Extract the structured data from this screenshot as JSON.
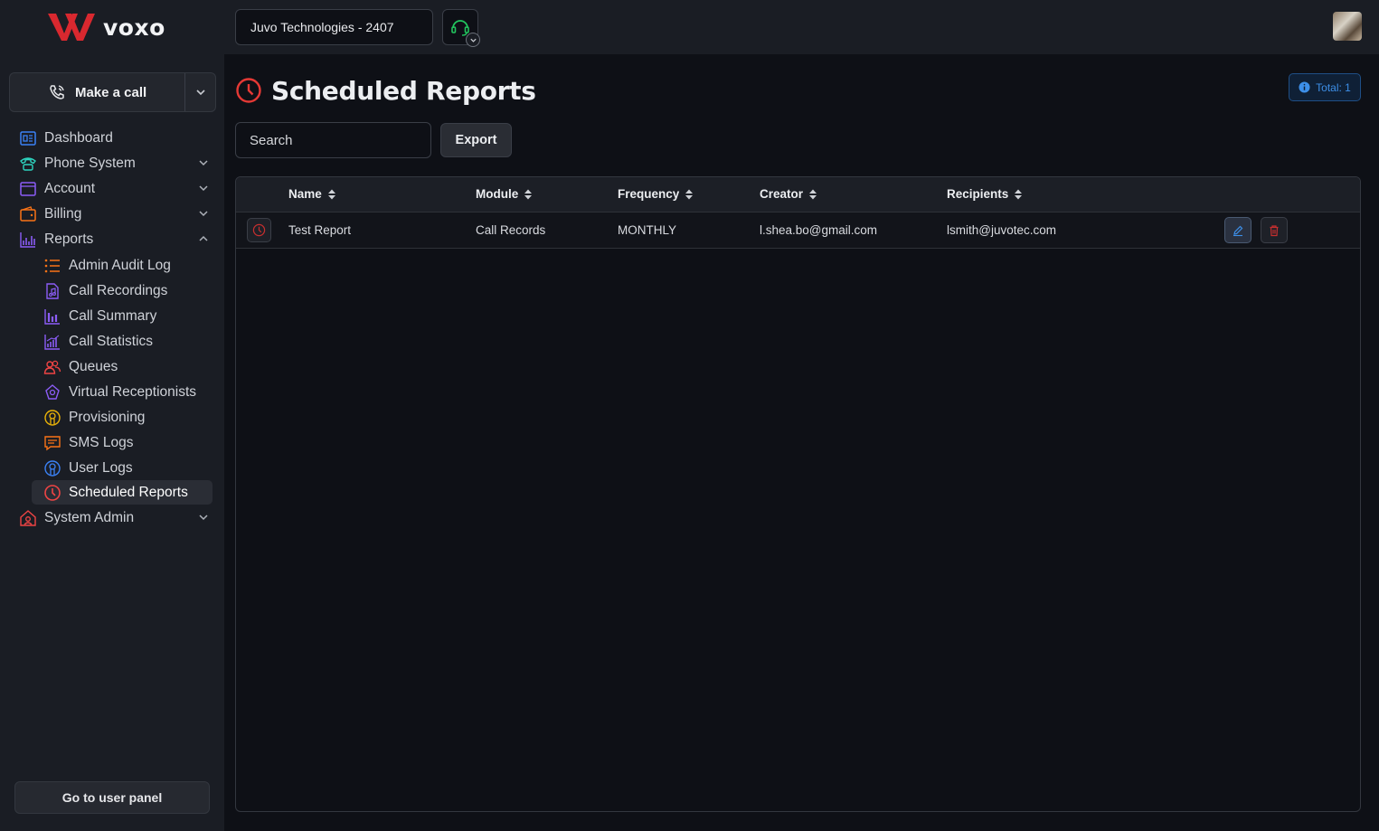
{
  "header": {
    "logo_text": "voxo",
    "org_selector": "Juvo Technologies - 2407"
  },
  "sidebar": {
    "make_call_label": "Make a call",
    "items": [
      {
        "label": "Dashboard",
        "icon": "dashboard-icon"
      },
      {
        "label": "Phone System",
        "icon": "phone-icon"
      },
      {
        "label": "Account",
        "icon": "account-icon"
      },
      {
        "label": "Billing",
        "icon": "wallet-icon"
      },
      {
        "label": "Reports",
        "icon": "chart-icon"
      },
      {
        "label": "System Admin",
        "icon": "admin-icon"
      }
    ],
    "report_items": [
      {
        "label": "Admin Audit Log",
        "icon": "list-icon"
      },
      {
        "label": "Call Recordings",
        "icon": "music-file-icon"
      },
      {
        "label": "Call Summary",
        "icon": "bar-chart-icon"
      },
      {
        "label": "Call Statistics",
        "icon": "statistics-icon"
      },
      {
        "label": "Queues",
        "icon": "users-icon"
      },
      {
        "label": "Virtual Receptionists",
        "icon": "receptionist-icon"
      },
      {
        "label": "Provisioning",
        "icon": "provisioning-icon"
      },
      {
        "label": "SMS Logs",
        "icon": "sms-icon"
      },
      {
        "label": "User Logs",
        "icon": "user-icon"
      },
      {
        "label": "Scheduled Reports",
        "icon": "clock-icon"
      }
    ],
    "user_panel_label": "Go to user panel"
  },
  "main": {
    "title": "Scheduled Reports",
    "total_badge": "Total: 1",
    "search_placeholder": "Search",
    "export_label": "Export",
    "columns": [
      "Name",
      "Module",
      "Frequency",
      "Creator",
      "Recipients"
    ],
    "rows": [
      {
        "name": "Test Report",
        "module": "Call Records",
        "frequency": "MONTHLY",
        "creator": "l.shea.bo@gmail.com",
        "recipients": "lsmith@juvotec.com"
      }
    ]
  },
  "colors": {
    "accent_red": "#e53935",
    "brand_red": "#d9282f",
    "info_blue": "#3d8fe8",
    "success_green": "#22c55e"
  }
}
